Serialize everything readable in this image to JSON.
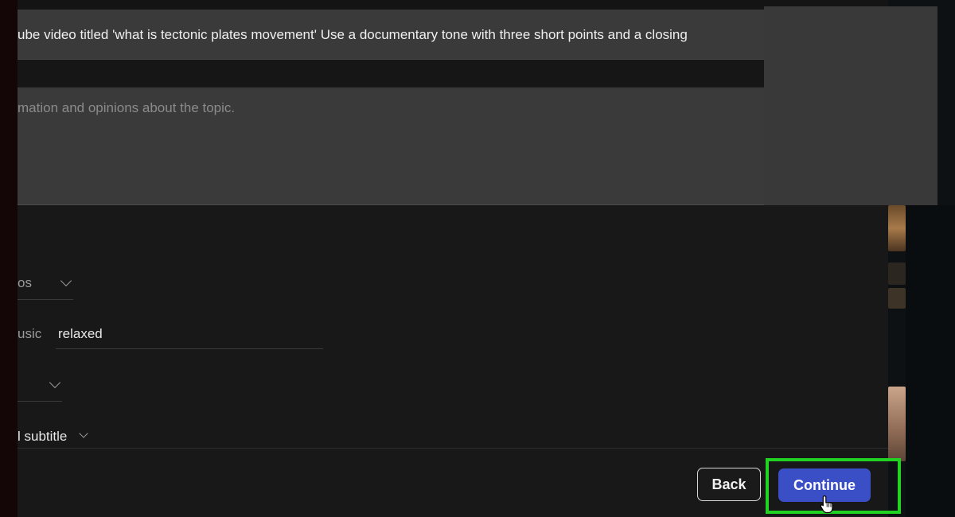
{
  "prompt": {
    "text": "ube video titled 'what is tectonic plates movement' Use a documentary tone with three short points and a closing"
  },
  "description": {
    "placeholder": "mation and opinions about the topic."
  },
  "fields": {
    "dropdown1": {
      "label": "os"
    },
    "music": {
      "label": "usic",
      "value": "relaxed"
    },
    "subtitle": {
      "label": "l subtitle"
    }
  },
  "footer": {
    "back_label": "Back",
    "continue_label": "Continue"
  },
  "colors": {
    "continue_button": "#3a4fc6",
    "highlight": "#22d222"
  },
  "icons": {
    "cursor": "hand-pointer-icon",
    "chevron": "chevron-down-icon"
  }
}
